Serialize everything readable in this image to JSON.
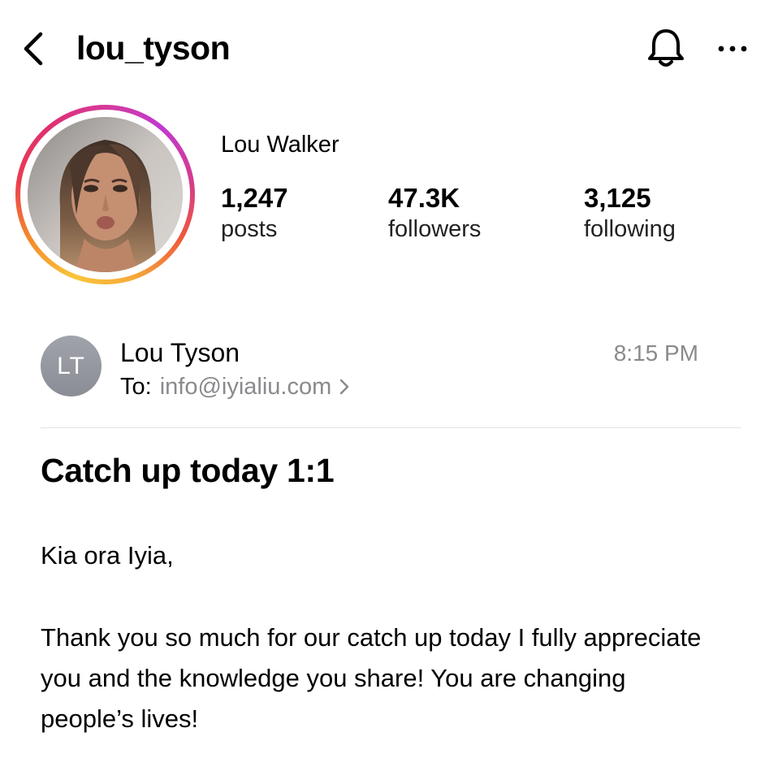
{
  "header": {
    "username": "lou_tyson",
    "back_icon": "chevron-left-icon",
    "bell_icon": "bell-icon",
    "more_icon": "ellipsis-icon"
  },
  "profile": {
    "display_name": "Lou Walker",
    "stats": [
      {
        "value": "1,247",
        "label": "posts"
      },
      {
        "value": "47.3K",
        "label": "followers"
      },
      {
        "value": "3,125",
        "label": "following"
      }
    ],
    "story_ring_colors": [
      "#f9c53c",
      "#f48a2a",
      "#ea3b4f",
      "#d43a9a",
      "#c13ad0"
    ]
  },
  "email": {
    "sender_initials": "LT",
    "sender_name": "Lou Tyson",
    "time": "8:15 PM",
    "to_label": "To:",
    "to_address": "info@iyialiu.com",
    "subject": "Catch up today 1:1",
    "greeting": "Kia ora Iyia,",
    "body": "Thank you so much for our catch up today I fully appreciate you and the knowledge you share! You are changing people’s lives!"
  }
}
